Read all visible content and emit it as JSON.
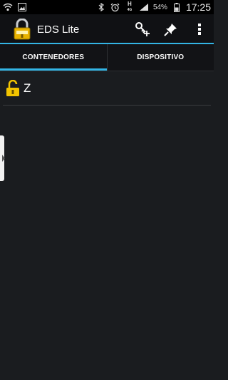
{
  "status_bar": {
    "battery": "54%",
    "time": "17:25",
    "network": "H",
    "network_sub": "4G",
    "icons": [
      "wifi-icon",
      "image-icon",
      "bluetooth-icon",
      "alarm-icon",
      "signal-icon",
      "battery-icon"
    ]
  },
  "action_bar": {
    "title": "EDS Lite",
    "actions": [
      "add-key-icon",
      "pin-icon",
      "overflow-menu-icon"
    ]
  },
  "tabs": [
    {
      "label": "CONTENEDORES",
      "active": true
    },
    {
      "label": "DISPOSITIVO",
      "active": false
    }
  ],
  "containers": [
    {
      "label": "Z",
      "icon": "unlocked-padlock-icon"
    }
  ],
  "colors": {
    "accent": "#33b5e5",
    "lock_yellow": "#f2c400",
    "background": "#1a1c1f"
  }
}
